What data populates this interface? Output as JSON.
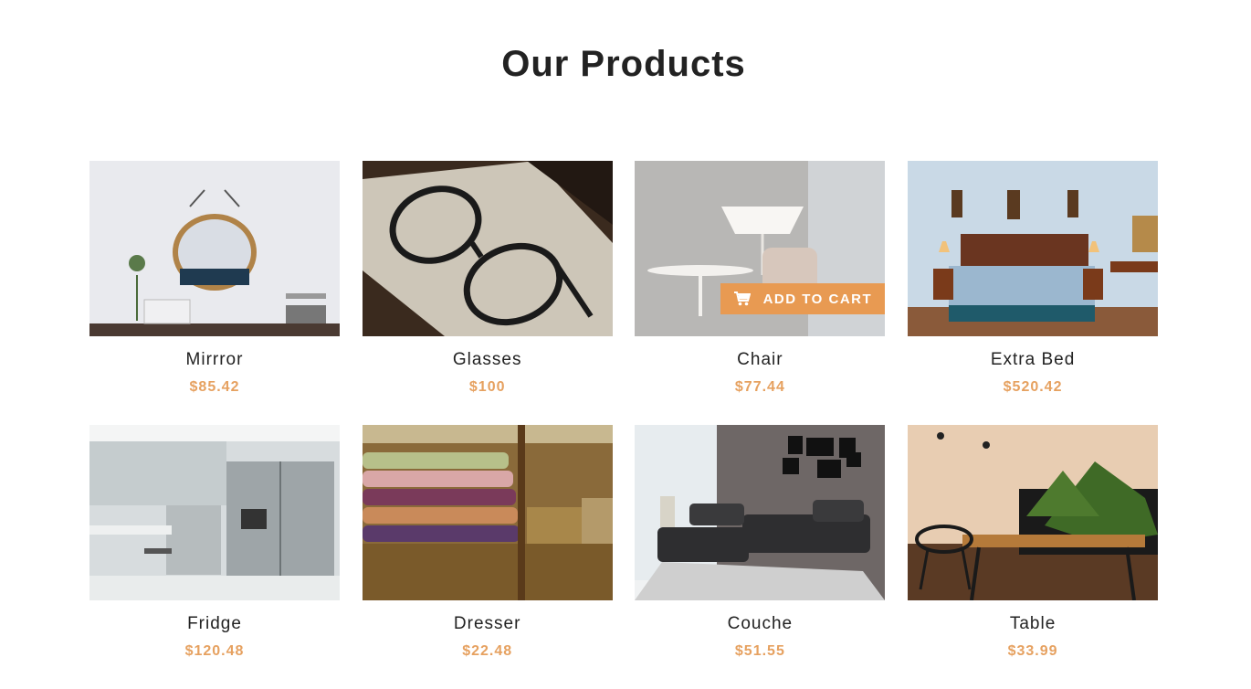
{
  "section": {
    "title": "Our Products"
  },
  "accent_color": "#e89a52",
  "products": [
    {
      "name": "Mirrror",
      "price": "$85.42",
      "image": "mirror-photo"
    },
    {
      "name": "Glasses",
      "price": "$100",
      "image": "glasses-photo"
    },
    {
      "name": "Chair",
      "price": "$77.44",
      "image": "lamp-chair-photo",
      "hovered": true
    },
    {
      "name": "Extra Bed",
      "price": "$520.42",
      "image": "bedroom-photo"
    },
    {
      "name": "Fridge",
      "price": "$120.48",
      "image": "kitchen-fridge-photo"
    },
    {
      "name": "Dresser",
      "price": "$22.48",
      "image": "towels-shelf-photo"
    },
    {
      "name": "Couche",
      "price": "$51.55",
      "image": "sofa-photo"
    },
    {
      "name": "Table",
      "price": "$33.99",
      "image": "table-plant-photo"
    }
  ],
  "cart_button": {
    "label": "ADD TO CART",
    "icon": "cart-icon"
  }
}
